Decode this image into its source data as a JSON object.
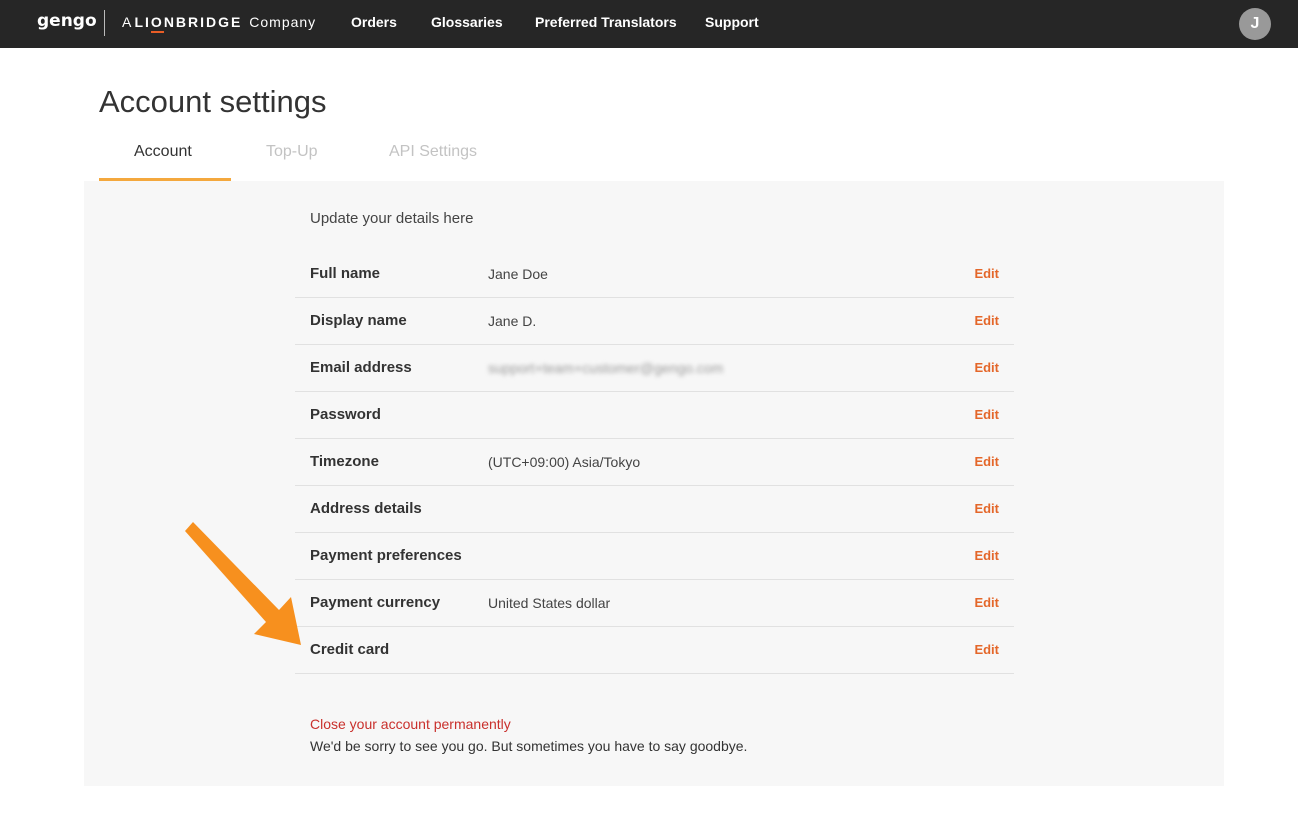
{
  "navbar": {
    "logo": "gengo",
    "brand_prefix": "A",
    "brand_name_left": "LI",
    "brand_name_o": "O",
    "brand_name_right": "NBRIDGE",
    "brand_suffix": "Company",
    "links": [
      "Orders",
      "Glossaries",
      "Preferred Translators",
      "Support"
    ],
    "avatar_initial": "J"
  },
  "page": {
    "title": "Account settings",
    "tabs": [
      "Account",
      "Top-Up",
      "API Settings"
    ],
    "active_tab": "Account",
    "intro": "Update your details here"
  },
  "rows": [
    {
      "label": "Full name",
      "value": "Jane Doe",
      "edit": "Edit"
    },
    {
      "label": "Display name",
      "value": "Jane D.",
      "edit": "Edit"
    },
    {
      "label": "Email address",
      "value": "support+team+customer@gengo.com",
      "value_blurred": true,
      "edit": "Edit"
    },
    {
      "label": "Password",
      "value": "",
      "edit": "Edit"
    },
    {
      "label": "Timezone",
      "value": "(UTC+09:00) Asia/Tokyo",
      "edit": "Edit"
    },
    {
      "label": "Address details",
      "value": "",
      "edit": "Edit"
    },
    {
      "label": "Payment preferences",
      "value": "",
      "edit": "Edit"
    },
    {
      "label": "Payment currency",
      "value": "United States dollar",
      "edit": "Edit"
    },
    {
      "label": "Credit card",
      "value": "",
      "edit": "Edit"
    }
  ],
  "footer": {
    "close_link": "Close your account permanently",
    "close_note": "We'd be sorry to see you go. But sometimes you have to say goodbye."
  },
  "annotation": {
    "arrow_color": "#f7901e",
    "points_to": "Credit card"
  },
  "colors": {
    "navbar": "#262626",
    "edit": "#e4672a",
    "tab_accent": "#f4a83d",
    "danger": "#c9302c"
  }
}
